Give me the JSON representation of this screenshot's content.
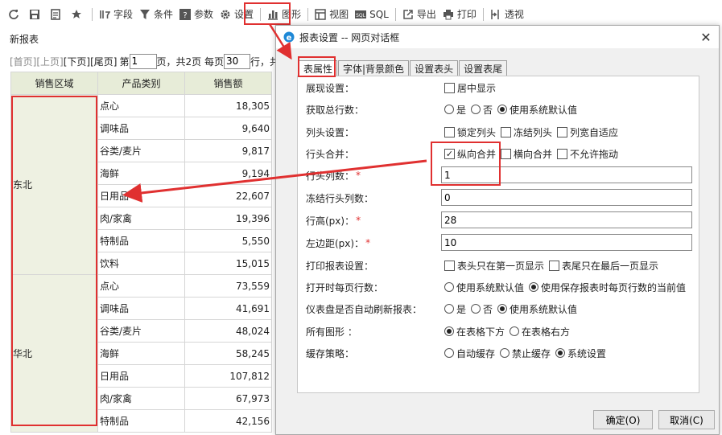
{
  "toolbar": {
    "items": [
      {
        "label": "",
        "icon": "refresh-icon"
      },
      {
        "label": "",
        "icon": "save-icon"
      },
      {
        "label": "",
        "icon": "document-icon"
      },
      {
        "label": "",
        "icon": "star-icon"
      },
      {
        "label": "字段",
        "icon": "field-icon"
      },
      {
        "label": "条件",
        "icon": "filter-icon"
      },
      {
        "label": "参数",
        "icon": "question-icon"
      },
      {
        "label": "设置",
        "icon": "gear-icon"
      },
      {
        "label": "图形",
        "icon": "bar-chart-icon"
      },
      {
        "label": "视图",
        "icon": "view-icon"
      },
      {
        "label": "SQL",
        "icon": "sql-icon"
      },
      {
        "label": "导出",
        "icon": "export-icon"
      },
      {
        "label": "打印",
        "icon": "printer-icon"
      },
      {
        "label": "透视",
        "icon": "pivot-icon"
      }
    ]
  },
  "report": {
    "title": "新报表",
    "pager": {
      "first": "[首页]",
      "prev": "[上页]",
      "next": "[下页]",
      "last": "[尾页]",
      "page_prefix": "第",
      "page_value": "1",
      "page_suffix": "页，共2页 每页",
      "per_page_value": "30",
      "per_page_suffix": "行，共"
    },
    "columns": [
      "销售区域",
      "产品类别",
      "销售额"
    ],
    "groups": [
      {
        "region": "东北",
        "rows": [
          {
            "cat": "点心",
            "value": "18,305"
          },
          {
            "cat": "调味品",
            "value": "9,640"
          },
          {
            "cat": "谷类/麦片",
            "value": "9,817"
          },
          {
            "cat": "海鲜",
            "value": "9,194"
          },
          {
            "cat": "日用品",
            "value": "22,607"
          },
          {
            "cat": "肉/家禽",
            "value": "19,396"
          },
          {
            "cat": "特制品",
            "value": "5,550"
          },
          {
            "cat": "饮料",
            "value": "15,015"
          }
        ]
      },
      {
        "region": "华北",
        "rows": [
          {
            "cat": "点心",
            "value": "73,559"
          },
          {
            "cat": "调味品",
            "value": "41,691"
          },
          {
            "cat": "谷类/麦片",
            "value": "48,024"
          },
          {
            "cat": "海鲜",
            "value": "58,245"
          },
          {
            "cat": "日用品",
            "value": "107,812"
          },
          {
            "cat": "肉/家禽",
            "value": "67,973"
          },
          {
            "cat": "特制品",
            "value": "42,156"
          }
        ]
      }
    ]
  },
  "dialog": {
    "title": "报表设置 -- 网页对话框",
    "close": "✕",
    "tabs": [
      "表属性",
      "字体|背景颜色",
      "设置表头",
      "设置表尾"
    ],
    "settings": {
      "display": {
        "label": "展现设置：",
        "options": [
          {
            "text": "居中显示",
            "checked": false
          }
        ]
      },
      "total_rows": {
        "label": "获取总行数：",
        "options": [
          {
            "text": "是",
            "checked": false
          },
          {
            "text": "否",
            "checked": false
          },
          {
            "text": "使用系统默认值",
            "checked": true
          }
        ]
      },
      "col_head": {
        "label": "列头设置：",
        "options": [
          {
            "text": "锁定列头",
            "checked": false
          },
          {
            "text": "冻结列头",
            "checked": false
          },
          {
            "text": "列宽自适应",
            "checked": false
          }
        ]
      },
      "row_merge": {
        "label": "行头合并：",
        "options": [
          {
            "text": "纵向合并",
            "checked": true
          },
          {
            "text": "横向合并",
            "checked": false
          },
          {
            "text": "不允许拖动",
            "checked": false
          }
        ]
      },
      "row_head_cols": {
        "label": "行头列数：",
        "required": "*",
        "value": "1"
      },
      "frozen_cols": {
        "label": "冻结行头列数：",
        "value": "0"
      },
      "row_height": {
        "label": "行高(px)：",
        "required": "*",
        "value": "28"
      },
      "left_margin": {
        "label": "左边距(px)：",
        "required": "*",
        "value": "10"
      },
      "print": {
        "label": "打印报表设置：",
        "options": [
          {
            "text": "表头只在第一页显示",
            "checked": false
          },
          {
            "text": "表尾只在最后一页显示",
            "checked": false
          }
        ]
      },
      "rows_on_open": {
        "label": "打开时每页行数：",
        "options": [
          {
            "text": "使用系统默认值",
            "checked": false
          },
          {
            "text": "使用保存报表时每页行数的当前值",
            "checked": true
          }
        ]
      },
      "auto_refresh": {
        "label": "仪表盘是否自动刷新报表：",
        "options": [
          {
            "text": "是",
            "checked": false
          },
          {
            "text": "否",
            "checked": false
          },
          {
            "text": "使用系统默认值",
            "checked": true
          }
        ]
      },
      "all_charts": {
        "label": "所有图形 ：",
        "options": [
          {
            "text": "在表格下方",
            "checked": true
          },
          {
            "text": "在表格右方",
            "checked": false
          }
        ]
      },
      "cache": {
        "label": "缓存策略：",
        "options": [
          {
            "text": "自动缓存",
            "checked": false
          },
          {
            "text": "禁止缓存",
            "checked": false
          },
          {
            "text": "系统设置",
            "checked": true
          }
        ]
      }
    },
    "ok": "确定(O)",
    "cancel": "取消(C)"
  },
  "colors": {
    "highlight": "#e03030",
    "header_bg": "#e7ecd8",
    "region_bg": "#eef1e2"
  }
}
